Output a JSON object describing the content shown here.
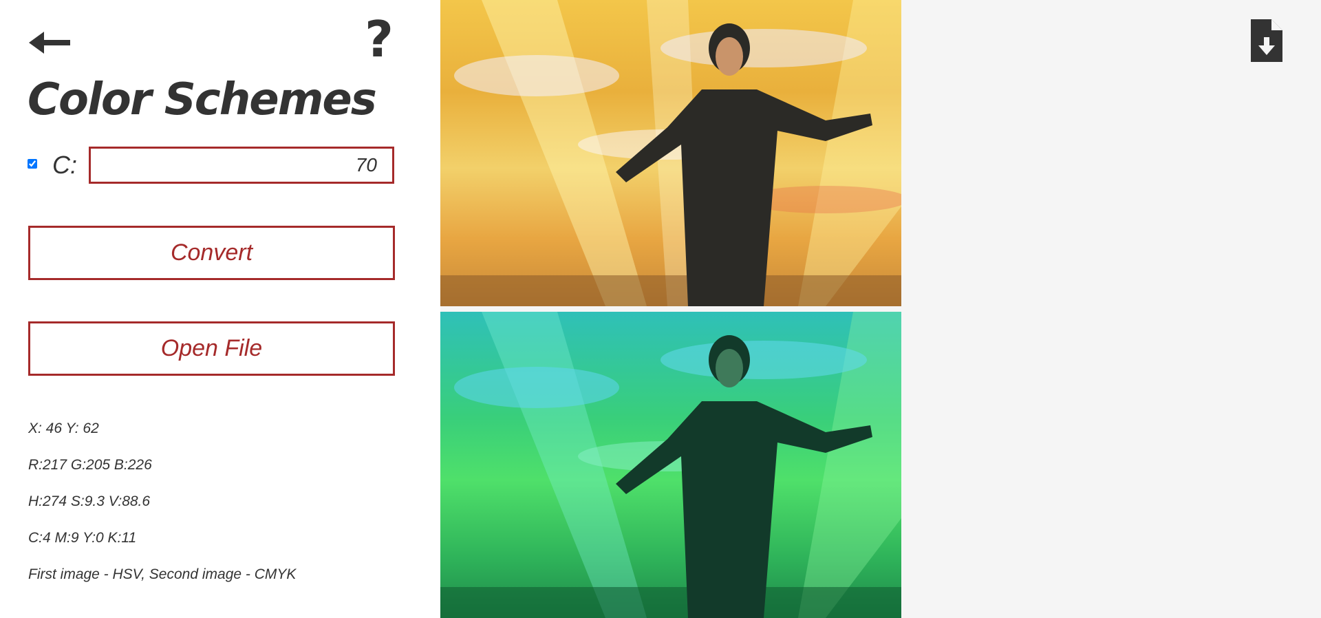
{
  "sidebar": {
    "back_icon": "arrow-left-icon",
    "help_icon": "question-mark-icon",
    "help_label": "?",
    "title": "Color Schemes",
    "channel": {
      "checked": true,
      "label": "C:",
      "value": "70"
    },
    "convert_label": "Convert",
    "open_file_label": "Open File",
    "info": {
      "coords": "X: 46 Y: 62",
      "rgb": "R:217 G:205 B:226",
      "hsv": "H:274 S:9.3 V:88.6",
      "cmyk": "C:4 M:9 Y:0 K:11",
      "legend": "First image - HSV, Second image - CMYK"
    }
  },
  "toolbar": {
    "download_icon": "file-download-icon"
  },
  "colors": {
    "accent": "#a52a2a",
    "text": "#333333",
    "background": "#f5f5f5",
    "sidebar": "#ffffff"
  }
}
